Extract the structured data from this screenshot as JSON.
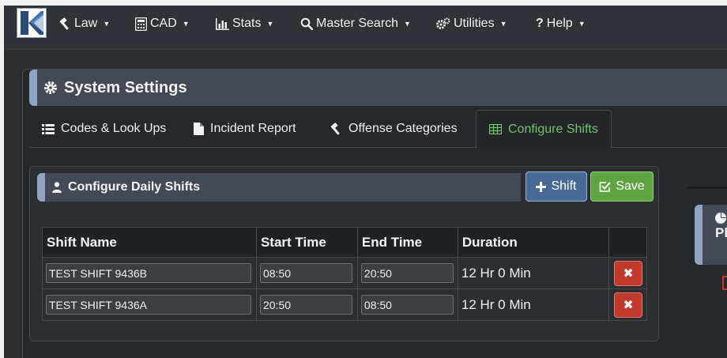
{
  "navbar": {
    "items": [
      {
        "label": "Law",
        "icon": "gavel-icon"
      },
      {
        "label": "CAD",
        "icon": "calculator-icon"
      },
      {
        "label": "Stats",
        "icon": "bar-chart-icon"
      },
      {
        "label": "Master Search",
        "icon": "search-icon"
      },
      {
        "label": "Utilities",
        "icon": "cogs-icon"
      },
      {
        "label": "Help",
        "icon": "question-icon"
      }
    ]
  },
  "page": {
    "title": "System Settings",
    "tabs": [
      {
        "label": "Codes & Look Ups",
        "icon": "list-icon"
      },
      {
        "label": "Incident Report",
        "icon": "file-icon"
      },
      {
        "label": "Offense Categories",
        "icon": "gavel-icon"
      },
      {
        "label": "Configure Shifts",
        "icon": "table-icon"
      }
    ]
  },
  "shifts_card": {
    "title": "Configure Daily Shifts",
    "add_shift_label": "Shift",
    "save_label": "Save",
    "columns": [
      "Shift Name",
      "Start Time",
      "End Time",
      "Duration"
    ],
    "rows": [
      {
        "name": "TEST SHIFT 9436B",
        "start": "08:50",
        "end": "20:50",
        "duration": "12 Hr 0 Min"
      },
      {
        "name": "TEST SHIFT 9436A",
        "start": "20:50",
        "end": "08:50",
        "duration": "12 Hr 0 Min"
      }
    ]
  },
  "side_panel": {
    "title_fragment": "Pl"
  },
  "colors": {
    "accent_active_tab": "#6fc46c",
    "header_bg": "#434956",
    "header_accent": "#8fa4c4",
    "primary_button": "#4a6a96",
    "success_button": "#5fa443",
    "danger_button": "#c0392b"
  }
}
